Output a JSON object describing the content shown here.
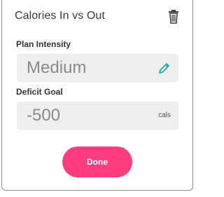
{
  "header": {
    "title": "Calories In vs Out",
    "trash_icon": "trash-icon"
  },
  "plan_intensity": {
    "label": "Plan Intensity",
    "value": "Medium",
    "edit_icon": "pencil-icon"
  },
  "deficit_goal": {
    "label": "Deficit Goal",
    "value": "-500",
    "unit": "cals"
  },
  "actions": {
    "done_label": "Done"
  },
  "colors": {
    "accent": "#ff3d7f",
    "pencil": "#2aa9a0",
    "field_bg": "#eeeeee"
  }
}
